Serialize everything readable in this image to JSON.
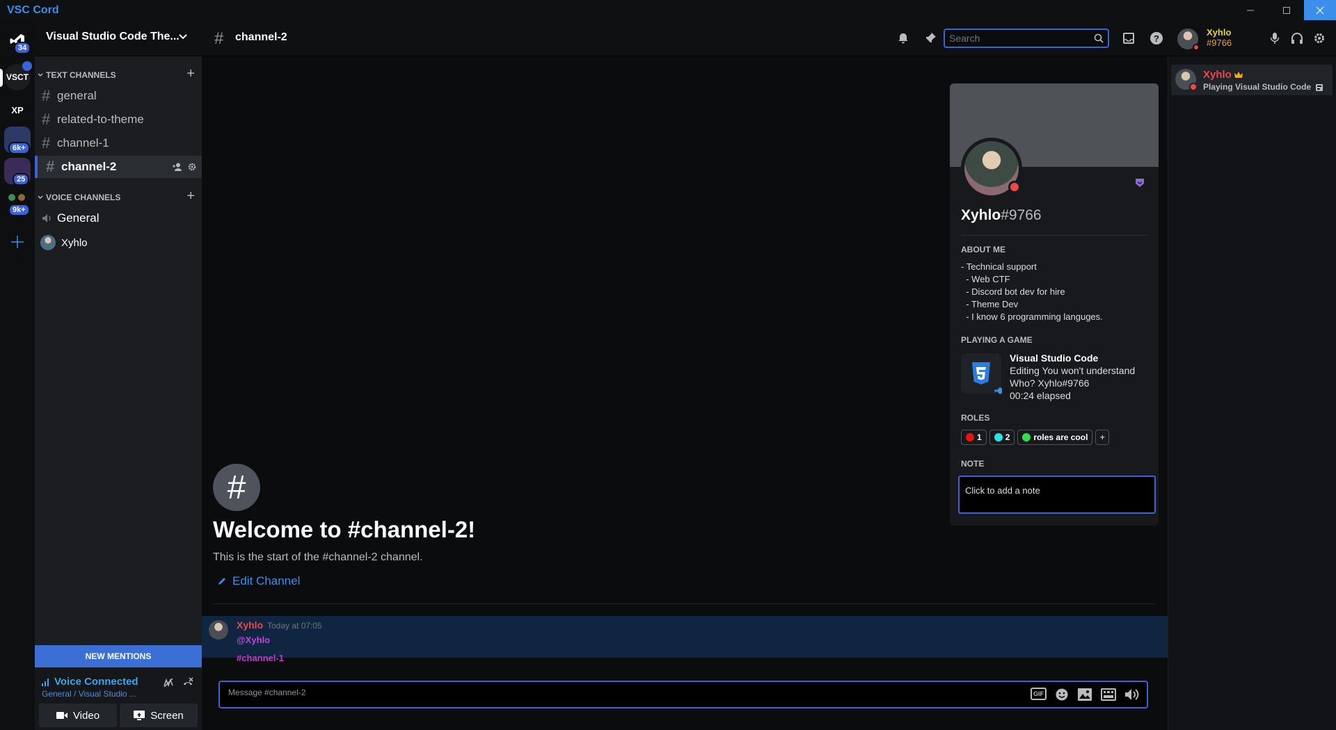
{
  "window": {
    "title": "VSC Cord"
  },
  "servers": [
    {
      "label": "VSCT",
      "badge": ""
    },
    {
      "label": "XP",
      "badge": ""
    },
    {
      "label": "",
      "badge": "6k+"
    },
    {
      "label": "",
      "badge": "25"
    },
    {
      "label": "",
      "badge": "9k+"
    }
  ],
  "home_badge": "34",
  "guild": {
    "name": "Visual Studio Code The..."
  },
  "channel": {
    "name": "channel-2"
  },
  "search": {
    "placeholder": "Search"
  },
  "user": {
    "name": "Xyhlo",
    "tag": "#9766"
  },
  "sidebar": {
    "text_category": "TEXT CHANNELS",
    "voice_category": "VOICE CHANNELS",
    "text_channels": [
      "general",
      "related-to-theme",
      "channel-1",
      "channel-2"
    ],
    "voice_channels": [
      "General"
    ],
    "voice_users": [
      "Xyhlo"
    ],
    "new_mentions": "NEW MENTIONS",
    "voice_status": "Voice Connected",
    "voice_sub": "General / Visual Studio ...",
    "video_label": "Video",
    "screen_label": "Screen"
  },
  "welcome": {
    "title": "Welcome to #channel-2!",
    "subtitle": "This is the start of the #channel-2 channel.",
    "edit": "Edit Channel"
  },
  "message": {
    "author": "Xyhlo",
    "time": "Today at 07:05",
    "mention": "@Xyhlo",
    "channel_link": "#channel-1"
  },
  "composer": {
    "placeholder": "Message #channel-2",
    "gif": "GIF"
  },
  "profile": {
    "name": "Xyhlo",
    "tag": "#9766",
    "about_header": "ABOUT ME",
    "about": "- Technical support\n  - Web CTF\n  - Discord bot dev for hire\n  - Theme Dev\n  - I know 6 programming languges.",
    "game_header": "PLAYING A GAME",
    "game_title": "Visual Studio Code",
    "game_line1": "Editing You won't understand",
    "game_line2": "Who? Xyhlo#9766",
    "game_line3": "00:24 elapsed",
    "roles_header": "ROLES",
    "roles": [
      {
        "label": "1",
        "color": "#e8140e"
      },
      {
        "label": "2",
        "color": "#2ee0e8"
      },
      {
        "label": "roles are cool",
        "color": "#2ee04a"
      }
    ],
    "role_add": "+",
    "note_header": "NOTE",
    "note_placeholder": "Click to add a note"
  },
  "members": [
    {
      "name": "Xyhlo",
      "activity": "Playing Visual Studio Code"
    }
  ],
  "colors": {
    "accent": "#3b62d6",
    "link": "#3b8eea",
    "dnd": "#f04747"
  }
}
